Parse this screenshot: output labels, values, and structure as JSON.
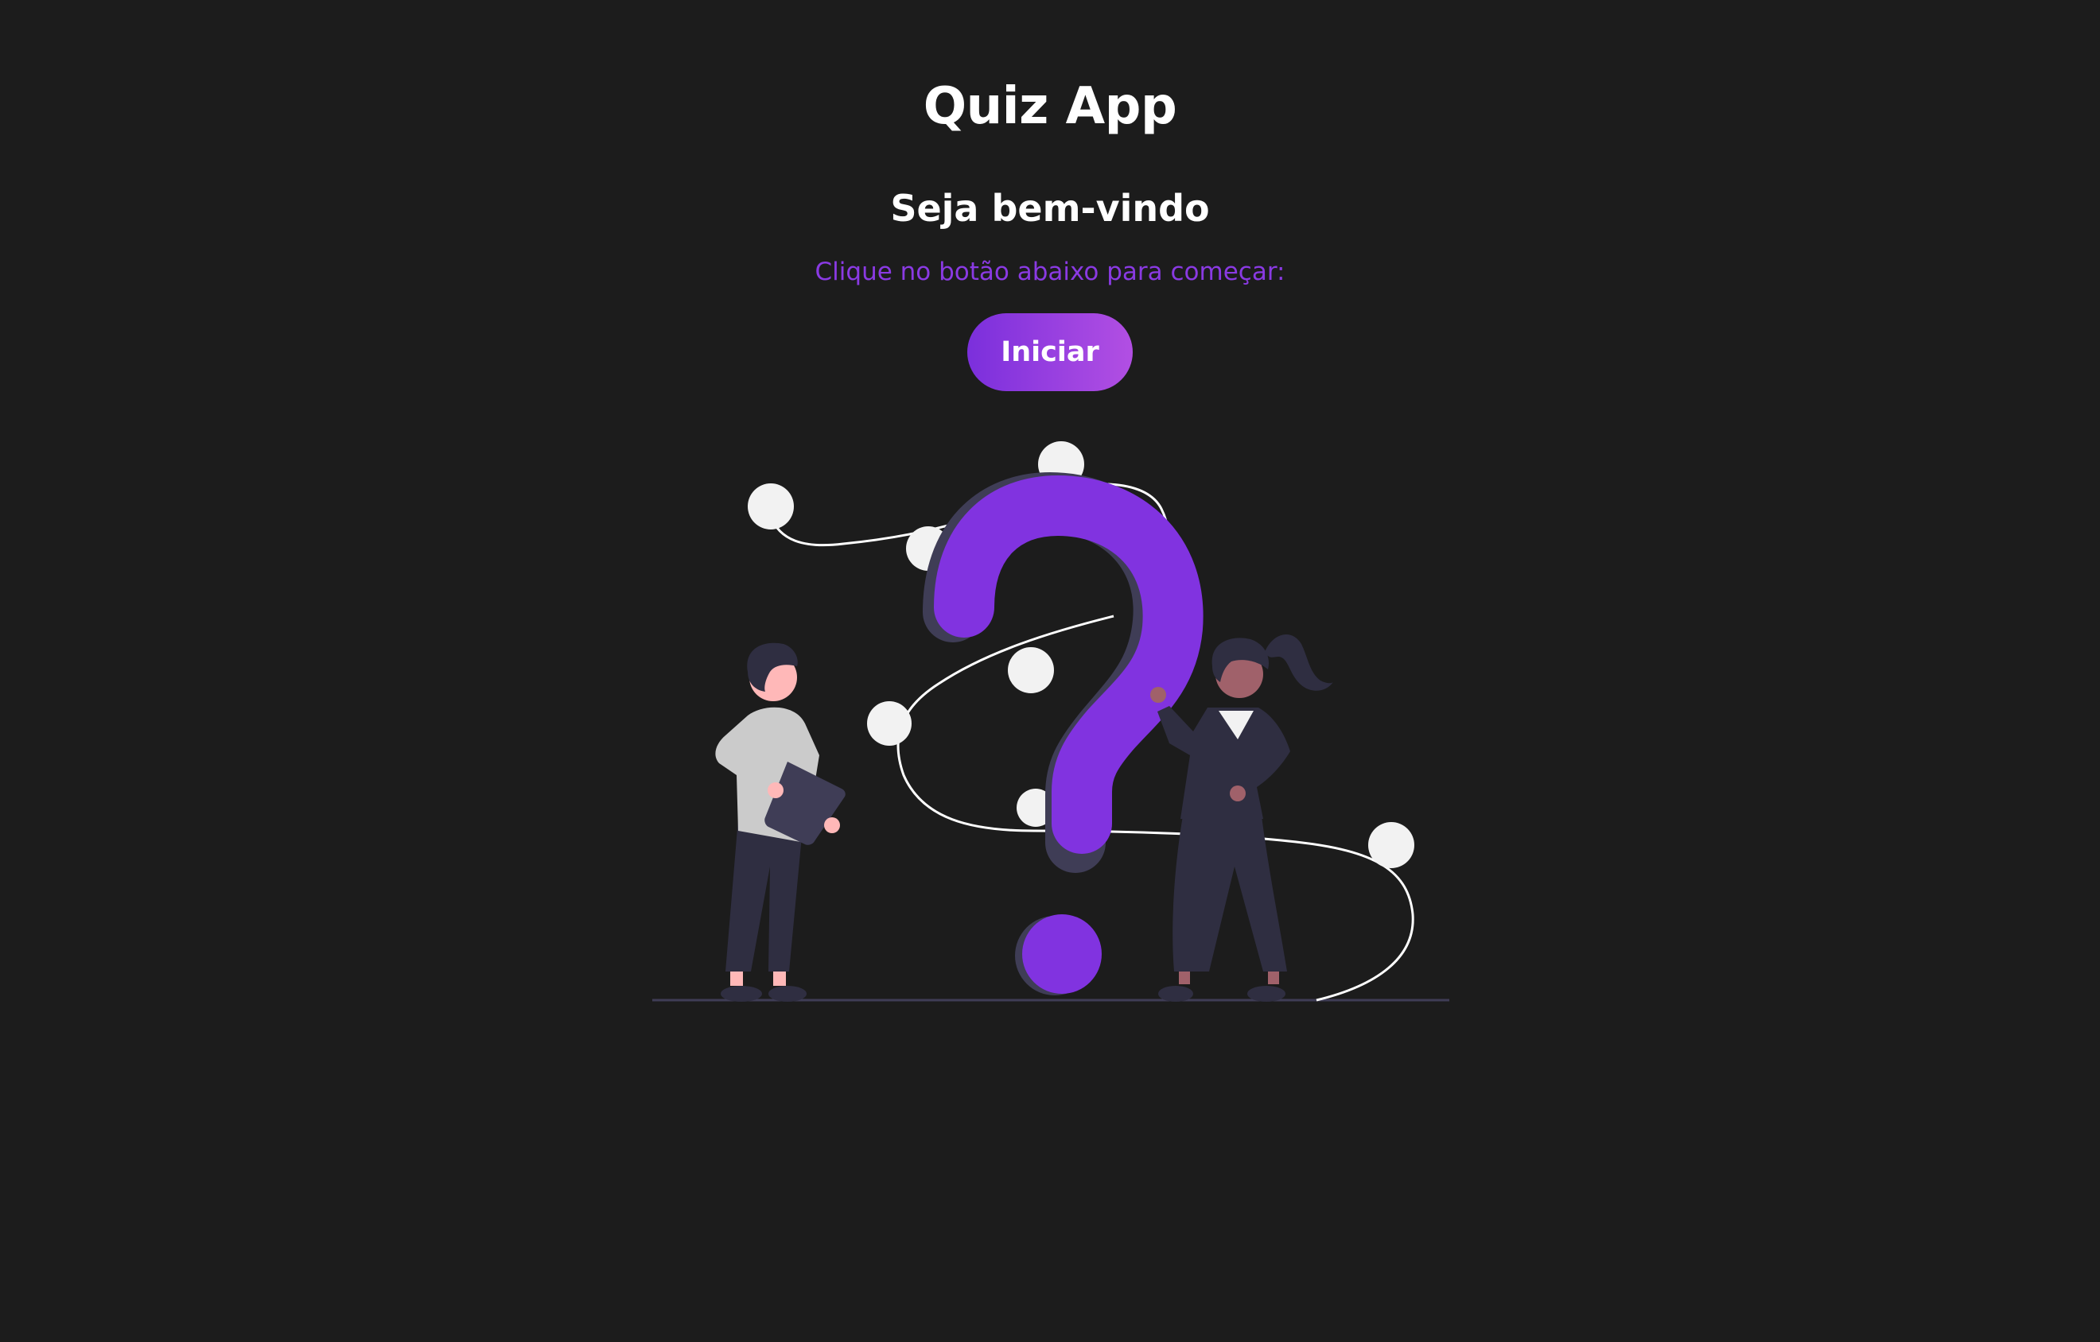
{
  "app": {
    "title": "Quiz App"
  },
  "welcome": {
    "heading": "Seja bem-vindo",
    "instruction": "Clique no botão abaixo para começar:",
    "start_button_label": "Iniciar"
  },
  "illustration": {
    "icon": "question-mark-illustration"
  },
  "colors": {
    "background": "#1c1c1c",
    "accent": "#8a3ae3",
    "button_gradient_start": "#7b2fdc",
    "button_gradient_end": "#b24fe3",
    "figure_dark": "#2f2e41",
    "skin_light": "#ffb8b8",
    "skin_dark": "#a0616a",
    "shirt_gray": "#cbcbcb",
    "dot_white": "#f2f2f2"
  }
}
